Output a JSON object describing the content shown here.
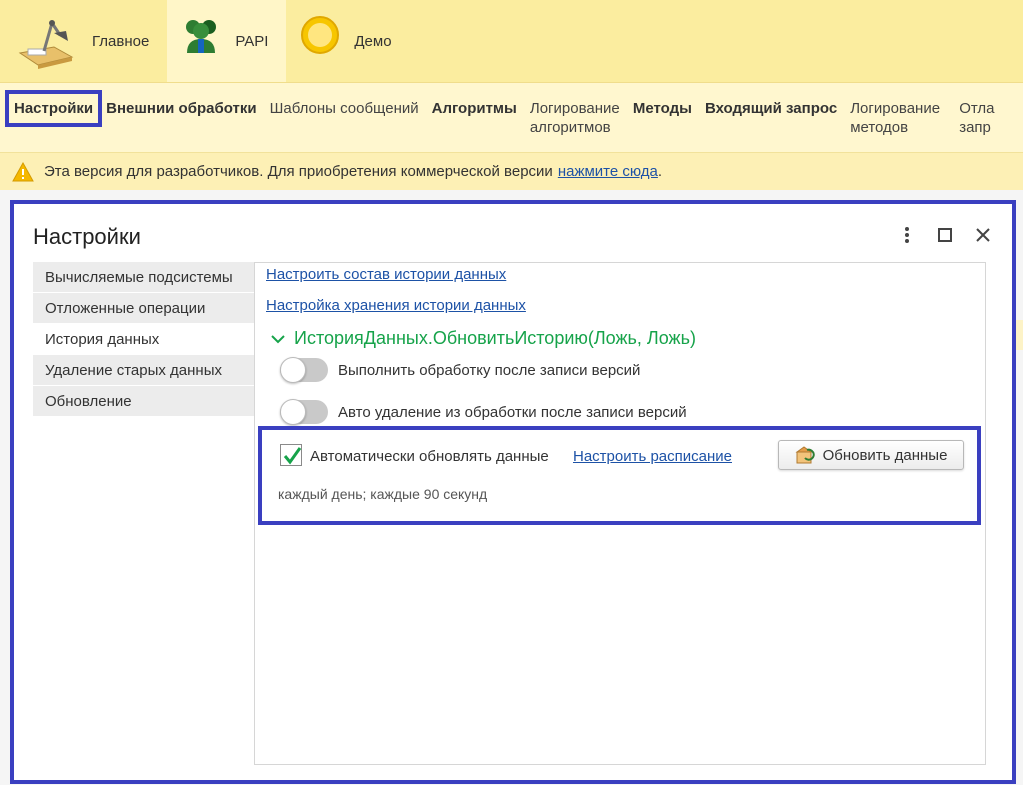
{
  "sections": [
    {
      "label": "Главное",
      "icon": "desk-lamp-icon"
    },
    {
      "label": "PAPI",
      "icon": "people-icon"
    },
    {
      "label": "Демо",
      "icon": "sun-circle-icon"
    }
  ],
  "commands": [
    {
      "label": "Настройки",
      "bold": true,
      "current": true
    },
    {
      "label": "Внешнии обработки",
      "bold": true
    },
    {
      "label": "Шаблоны сообщений",
      "bold": false
    },
    {
      "label": "Алгоритмы",
      "bold": true
    },
    {
      "label": "Логирование алгоритмов",
      "bold": false
    },
    {
      "label": "Методы",
      "bold": true
    },
    {
      "label": "Входящий запрос",
      "bold": true
    },
    {
      "label": "Логирование методов",
      "bold": false
    },
    {
      "label": "Отла запр",
      "bold": false
    }
  ],
  "warning": {
    "text": "Эта версия для разработчиков. Для приобретения коммерческой версии",
    "link": "нажмите сюда",
    "tail": "."
  },
  "dialog": {
    "title": "Настройки",
    "nav": [
      {
        "label": "Вычисляемые подсистемы",
        "active": false
      },
      {
        "label": "Отложенные операции",
        "active": false
      },
      {
        "label": "История данных",
        "active": true
      },
      {
        "label": "Удаление старых данных",
        "active": false
      },
      {
        "label": "Обновление",
        "active": false
      }
    ],
    "content": {
      "link1": "Настроить состав истории данных",
      "link2": "Настройка хранения истории данных",
      "group_title": "ИсторияДанных.ОбновитьИсторию(Ложь, Ложь)",
      "toggle1": "Выполнить обработку после записи версий",
      "toggle2": "Авто удаление из обработки после записи версий",
      "auto_update_label": "Автоматически обновлять данные",
      "auto_update_checked": true,
      "schedule_link": "Настроить расписание",
      "refresh_button": "Обновить данные",
      "schedule_text": "каждый день; каждые 90 секунд"
    }
  },
  "colors": {
    "highlight": "#3a3fc0",
    "link": "#1d52a6",
    "group": "#16a34a",
    "topbar": "#fbed9f"
  }
}
